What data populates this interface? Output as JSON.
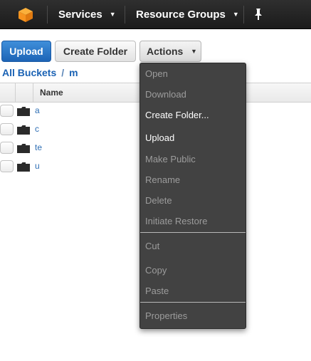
{
  "topbar": {
    "logo_icon": "aws-cube-icon",
    "nav": [
      {
        "label": "Services",
        "icon": "chevron-down-icon"
      },
      {
        "label": "Resource Groups",
        "icon": "chevron-down-icon"
      }
    ],
    "pin_icon": "pin-icon"
  },
  "toolbar": {
    "upload_label": "Upload",
    "create_folder_label": "Create Folder",
    "actions_label": "Actions"
  },
  "breadcrumb": {
    "root": "All Buckets",
    "separator": "/",
    "current": "m"
  },
  "table": {
    "columns": [
      "Name"
    ],
    "rows": [
      {
        "name": "a"
      },
      {
        "name": "c"
      },
      {
        "name": "te"
      },
      {
        "name": "u"
      }
    ]
  },
  "actions_menu": {
    "items": [
      {
        "label": "Open",
        "enabled": false
      },
      {
        "label": "Download",
        "enabled": false
      },
      {
        "label": "Create Folder...",
        "enabled": true
      },
      {
        "label": "Upload",
        "enabled": true
      },
      {
        "label": "Make Public",
        "enabled": false
      },
      {
        "label": "Rename",
        "enabled": false
      },
      {
        "label": "Delete",
        "enabled": false
      },
      {
        "label": "Initiate Restore",
        "enabled": false
      },
      {
        "label": "Cut",
        "enabled": false
      },
      {
        "label": "Copy",
        "enabled": false
      },
      {
        "label": "Paste",
        "enabled": false
      },
      {
        "label": "Properties",
        "enabled": false
      }
    ]
  },
  "colors": {
    "accent": "#1d64b6",
    "topbar": "#232323",
    "menu_bg": "#424242",
    "logo": "#f79b1e"
  }
}
